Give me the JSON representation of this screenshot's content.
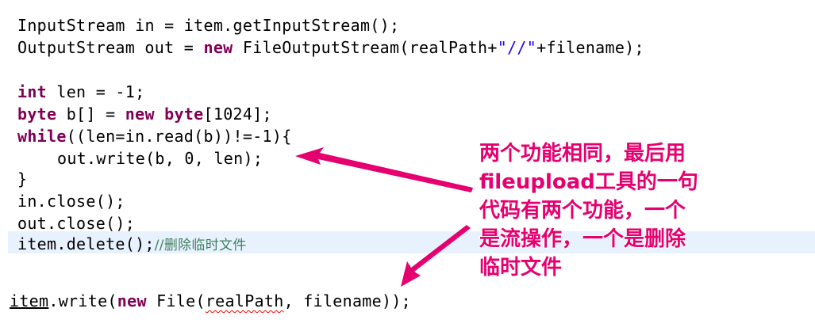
{
  "code": {
    "line1": {
      "type1": "InputStream",
      "rest": " in = item.getInputStream();"
    },
    "line2": {
      "type1": "OutputStream out = ",
      "kw": "new",
      "mid": " FileOutputStream(realPath+",
      "str": "\"//\"",
      "end": "+filename);"
    },
    "line3": {
      "kw": "int",
      "rest": " len = -1;"
    },
    "line4": {
      "kw1": "byte",
      "mid": " b[] = ",
      "kw2": "new",
      "sp": " ",
      "kw3": "byte",
      "end": "[1024];"
    },
    "line5": {
      "kw": "while",
      "rest": "((len=in.read(b))!=-1){"
    },
    "line6": {
      "text": "out.write(b, 0, len);"
    },
    "line7": {
      "text": "}"
    },
    "line8": {
      "text": "in.close();"
    },
    "line9": {
      "text": "out.close();"
    },
    "line10": {
      "text": "item.delete();",
      "comment": "//删除临时文件"
    },
    "bottom": {
      "item": "item",
      "mid1": ".write(",
      "kw": "new",
      "mid2": " File(",
      "squig": "realPath",
      "end": ", filename));"
    }
  },
  "annotation": {
    "line1": "两个功能相同，最后用",
    "line2_bold": "fileupload",
    "line2_rest": "工具的一句",
    "line3": "代码有两个功能，一个",
    "line4": "是流操作，一个是删除",
    "line5": "临时文件"
  },
  "colors": {
    "keyword": "#7f0055",
    "string": "#2a00ff",
    "comment": "#3f7f5f",
    "annotation": "#e6006f",
    "highlight": "#e8f2fe"
  }
}
